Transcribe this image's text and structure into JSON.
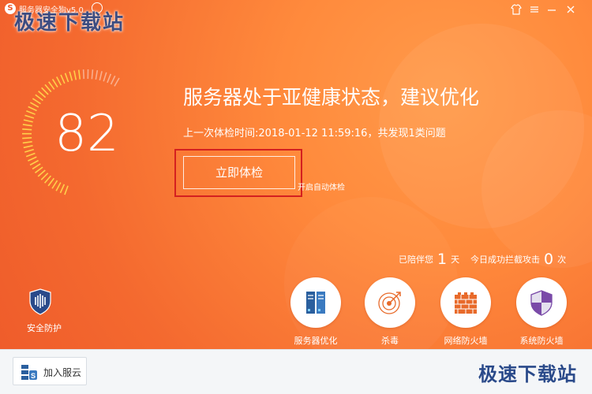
{
  "titlebar": {
    "app_title": "服务器安全狗v5.0",
    "watermark": "极速下载站"
  },
  "status": {
    "score": "82",
    "headline": "服务器处于亚健康状态，建议优化",
    "last_check": "上一次体检时间:2018-01-12 11:59:16，共发现1类问题"
  },
  "actions": {
    "check_now": "立即体检",
    "auto_check": "开启自动体检"
  },
  "stats": {
    "days_label": "已陪伴您",
    "days_value": "1",
    "days_unit": "天",
    "attacks_label": "今日成功拦截攻击",
    "attacks_value": "0",
    "attacks_unit": "次"
  },
  "protection": {
    "label": "安全防护"
  },
  "tools": [
    {
      "label": "服务器优化",
      "icon": "server-icon"
    },
    {
      "label": "杀毒",
      "icon": "antivirus-target-icon"
    },
    {
      "label": "网络防火墙",
      "icon": "brick-wall-icon"
    },
    {
      "label": "系统防火墙",
      "icon": "shield-icon"
    }
  ],
  "bottombar": {
    "cloud_label": "加入服云",
    "watermark": "极速下载站"
  },
  "colors": {
    "bg_orange": "#f4692f",
    "highlight_red": "#d42020",
    "server_blue": "#2a5f9e",
    "shield_purple": "#7a4aa8",
    "brick_orange": "#e86a2a"
  }
}
